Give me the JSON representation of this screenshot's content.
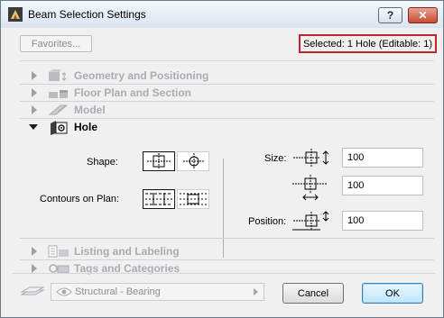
{
  "window": {
    "title": "Beam Selection Settings",
    "help_label": "?",
    "close_label": "✕"
  },
  "toolbar": {
    "favorites_label": "Favorites...",
    "selection_info": "Selected: 1 Hole (Editable: 1)"
  },
  "sections_top": [
    {
      "label": "Geometry and Positioning",
      "icon": "geometry-icon",
      "expanded": false
    },
    {
      "label": "Floor Plan and Section",
      "icon": "floor-plan-icon",
      "expanded": false
    },
    {
      "label": "Model",
      "icon": "model-icon",
      "expanded": false
    }
  ],
  "hole": {
    "label": "Hole",
    "icon": "hole-icon",
    "expanded": true,
    "shape_label": "Shape:",
    "shape_selected": "rectangular",
    "contours_label": "Contours on Plan:",
    "contours_selected": "dashed-outline",
    "size_label": "Size:",
    "size_width": "100",
    "size_height": "100",
    "position_label": "Position:",
    "position_value": "100"
  },
  "sections_bottom": [
    {
      "label": "Listing and Labeling",
      "icon": "listing-icon",
      "expanded": false
    },
    {
      "label": "Tags and Categories",
      "icon": "tags-icon",
      "expanded": false
    }
  ],
  "footer": {
    "profile_label": "Structural - Bearing",
    "cancel_label": "Cancel",
    "ok_label": "OK"
  },
  "colors": {
    "highlight_border": "#c0262b",
    "ok_accent": "#3c7fb1"
  }
}
